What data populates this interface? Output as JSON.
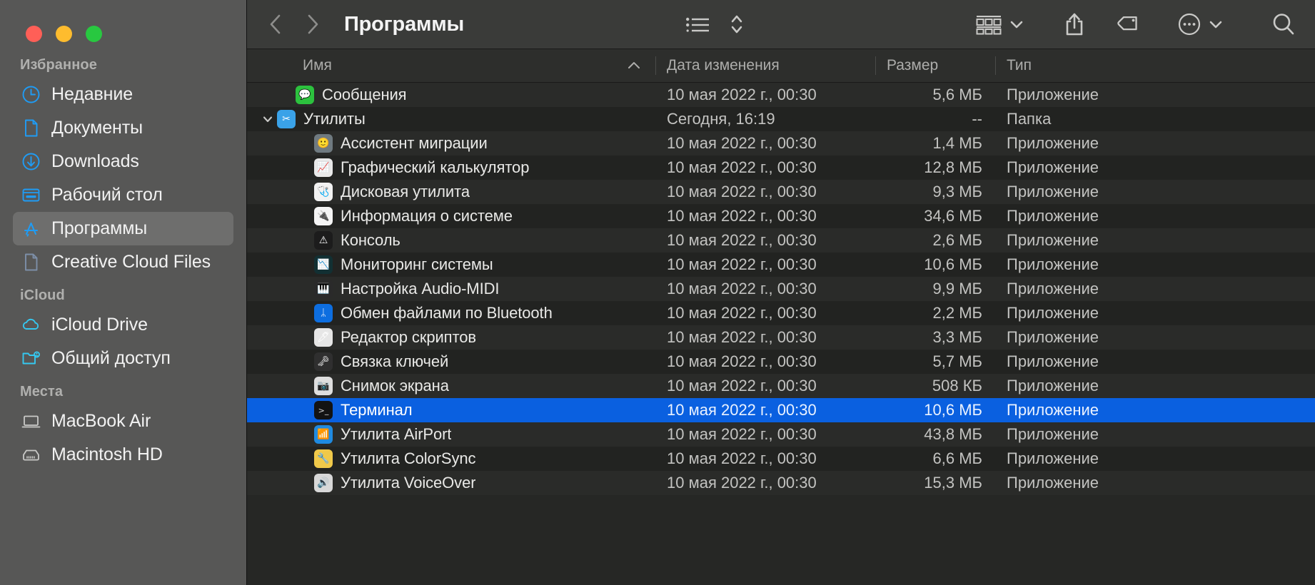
{
  "window": {
    "title": "Программы",
    "traffic_lights": [
      {
        "name": "close",
        "color": "#ff5f57"
      },
      {
        "name": "minimize",
        "color": "#febc2e"
      },
      {
        "name": "maximize",
        "color": "#28c840"
      }
    ]
  },
  "toolbar": {
    "back_icon": "chevron-left-icon",
    "forward_icon": "chevron-right-icon",
    "view_list_icon": "list-view-icon",
    "view_stepper_icon": "up-down-chevron-icon",
    "group_icon": "group-by-icon",
    "group_chevron_icon": "chevron-down-icon",
    "share_icon": "share-icon",
    "tag_icon": "tag-icon",
    "more_icon": "ellipsis-circle-icon",
    "more_chevron_icon": "chevron-down-icon",
    "search_icon": "search-icon"
  },
  "sidebar": {
    "groups": [
      {
        "title": "Избранное",
        "items": [
          {
            "label": "Недавние",
            "icon": "clock-icon",
            "color": "#1f9cf5",
            "selected": false
          },
          {
            "label": "Документы",
            "icon": "document-icon",
            "color": "#1f9cf5",
            "selected": false
          },
          {
            "label": "Downloads",
            "icon": "download-icon",
            "color": "#1f9cf5",
            "selected": false
          },
          {
            "label": "Рабочий стол",
            "icon": "desktop-icon",
            "color": "#1f9cf5",
            "selected": false
          },
          {
            "label": "Программы",
            "icon": "app-store-icon",
            "color": "#1f9cf5",
            "selected": true
          },
          {
            "label": "Creative Cloud Files",
            "icon": "document-icon",
            "color": "#7d8fa8",
            "selected": false
          }
        ]
      },
      {
        "title": "iCloud",
        "items": [
          {
            "label": "iCloud Drive",
            "icon": "cloud-icon",
            "color": "#35c8f0",
            "selected": false
          },
          {
            "label": "Общий доступ",
            "icon": "shared-folder-icon",
            "color": "#35c8f0",
            "selected": false
          }
        ]
      },
      {
        "title": "Места",
        "items": [
          {
            "label": "MacBook Air",
            "icon": "laptop-icon",
            "color": "#c9c9c7",
            "selected": false
          },
          {
            "label": "Macintosh HD",
            "icon": "harddisk-icon",
            "color": "#c9c9c7",
            "selected": false
          }
        ]
      }
    ]
  },
  "columns": [
    {
      "key": "name",
      "label": "Имя",
      "sorted": true,
      "sort_dir": "asc"
    },
    {
      "key": "date",
      "label": "Дата изменения",
      "sorted": false,
      "sort_dir": ""
    },
    {
      "key": "size",
      "label": "Размер",
      "sorted": false,
      "sort_dir": ""
    },
    {
      "key": "type",
      "label": "Тип",
      "sorted": false,
      "sort_dir": ""
    }
  ],
  "rows": [
    {
      "name": "Сообщения",
      "date": "10 мая 2022 г., 00:30",
      "size": "5,6 МБ",
      "type": "Приложение",
      "indent": 1,
      "selected": false,
      "expandable": false,
      "expanded": false,
      "icon": "messages-icon",
      "icon_bg": "#2cc23e",
      "glyph": "💬"
    },
    {
      "name": "Утилиты",
      "date": "Сегодня, 16:19",
      "size": "--",
      "type": "Папка",
      "indent": 0,
      "selected": false,
      "expandable": true,
      "expanded": true,
      "icon": "utilities-folder-icon",
      "icon_bg": "#3aa2e8",
      "glyph": "✂"
    },
    {
      "name": "Ассистент миграции",
      "date": "10 мая 2022 г., 00:30",
      "size": "1,4 МБ",
      "type": "Приложение",
      "indent": 2,
      "selected": false,
      "expandable": false,
      "expanded": false,
      "icon": "migration-assistant-icon",
      "icon_bg": "#6f7a80",
      "glyph": "🙂"
    },
    {
      "name": "Графический калькулятор",
      "date": "10 мая 2022 г., 00:30",
      "size": "12,8 МБ",
      "type": "Приложение",
      "indent": 2,
      "selected": false,
      "expandable": false,
      "expanded": false,
      "icon": "grapher-icon",
      "icon_bg": "#e8e8e8",
      "glyph": "📈"
    },
    {
      "name": "Дисковая утилита",
      "date": "10 мая 2022 г., 00:30",
      "size": "9,3 МБ",
      "type": "Приложение",
      "indent": 2,
      "selected": false,
      "expandable": false,
      "expanded": false,
      "icon": "disk-utility-icon",
      "icon_bg": "#f2f2f2",
      "glyph": "🩺"
    },
    {
      "name": "Информация о системе",
      "date": "10 мая 2022 г., 00:30",
      "size": "34,6 МБ",
      "type": "Приложение",
      "indent": 2,
      "selected": false,
      "expandable": false,
      "expanded": false,
      "icon": "system-information-icon",
      "icon_bg": "#f4f4f4",
      "glyph": "🔌"
    },
    {
      "name": "Консоль",
      "date": "10 мая 2022 г., 00:30",
      "size": "2,6 МБ",
      "type": "Приложение",
      "indent": 2,
      "selected": false,
      "expandable": false,
      "expanded": false,
      "icon": "console-icon",
      "icon_bg": "#1c1c1c",
      "glyph": "⚠"
    },
    {
      "name": "Мониторинг системы",
      "date": "10 мая 2022 г., 00:30",
      "size": "10,6 МБ",
      "type": "Приложение",
      "indent": 2,
      "selected": false,
      "expandable": false,
      "expanded": false,
      "icon": "activity-monitor-icon",
      "icon_bg": "#123033",
      "glyph": "📉"
    },
    {
      "name": "Настройка Audio-MIDI",
      "date": "10 мая 2022 г., 00:30",
      "size": "9,9 МБ",
      "type": "Приложение",
      "indent": 2,
      "selected": false,
      "expandable": false,
      "expanded": false,
      "icon": "audio-midi-setup-icon",
      "icon_bg": "#2a2a2a",
      "glyph": "🎹"
    },
    {
      "name": "Обмен файлами по Bluetooth",
      "date": "10 мая 2022 г., 00:30",
      "size": "2,2 МБ",
      "type": "Приложение",
      "indent": 2,
      "selected": false,
      "expandable": false,
      "expanded": false,
      "icon": "bluetooth-sharing-icon",
      "icon_bg": "#0d6ee0",
      "glyph": "ᛦ"
    },
    {
      "name": "Редактор скриптов",
      "date": "10 мая 2022 г., 00:30",
      "size": "3,3 МБ",
      "type": "Приложение",
      "indent": 2,
      "selected": false,
      "expandable": false,
      "expanded": false,
      "icon": "script-editor-icon",
      "icon_bg": "#e6e6e6",
      "glyph": "🖊"
    },
    {
      "name": "Связка ключей",
      "date": "10 мая 2022 г., 00:30",
      "size": "5,7 МБ",
      "type": "Приложение",
      "indent": 2,
      "selected": false,
      "expandable": false,
      "expanded": false,
      "icon": "keychain-access-icon",
      "icon_bg": "#2f2f2f",
      "glyph": "🗝"
    },
    {
      "name": "Снимок экрана",
      "date": "10 мая 2022 г., 00:30",
      "size": "508 КБ",
      "type": "Приложение",
      "indent": 2,
      "selected": false,
      "expandable": false,
      "expanded": false,
      "icon": "screenshot-icon",
      "icon_bg": "#dedede",
      "glyph": "📷"
    },
    {
      "name": "Терминал",
      "date": "10 мая 2022 г., 00:30",
      "size": "10,6 МБ",
      "type": "Приложение",
      "indent": 2,
      "selected": true,
      "expandable": false,
      "expanded": false,
      "icon": "terminal-icon",
      "icon_bg": "#131313",
      "glyph": ">_"
    },
    {
      "name": "Утилита AirPort",
      "date": "10 мая 2022 г., 00:30",
      "size": "43,8 МБ",
      "type": "Приложение",
      "indent": 2,
      "selected": false,
      "expandable": false,
      "expanded": false,
      "icon": "airport-utility-icon",
      "icon_bg": "#1f8ae0",
      "glyph": "📶"
    },
    {
      "name": "Утилита ColorSync",
      "date": "10 мая 2022 г., 00:30",
      "size": "6,6 МБ",
      "type": "Приложение",
      "indent": 2,
      "selected": false,
      "expandable": false,
      "expanded": false,
      "icon": "colorsync-utility-icon",
      "icon_bg": "#f0c94a",
      "glyph": "🔧"
    },
    {
      "name": "Утилита VoiceOver",
      "date": "10 мая 2022 г., 00:30",
      "size": "15,3 МБ",
      "type": "Приложение",
      "indent": 2,
      "selected": false,
      "expandable": false,
      "expanded": false,
      "icon": "voiceover-utility-icon",
      "icon_bg": "#d8d8d8",
      "glyph": "🔊"
    }
  ]
}
